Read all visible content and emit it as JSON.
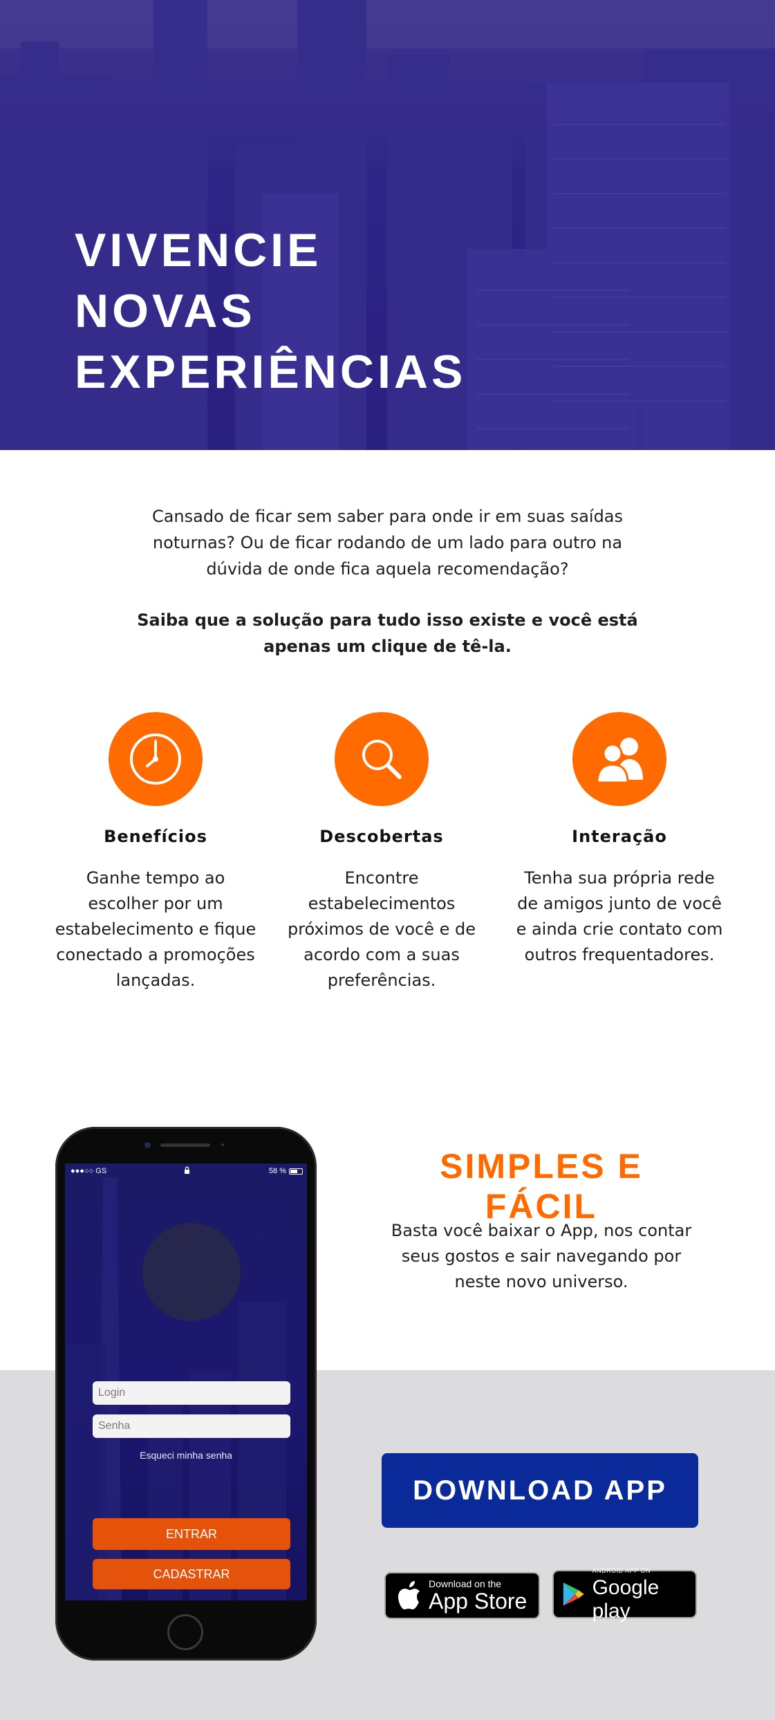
{
  "hero": {
    "title_lines": [
      "VIVENCIE",
      "NOVAS",
      "EXPERIÊNCIAS"
    ]
  },
  "intro": {
    "paragraph": "Cansado de ficar sem saber para onde ir em suas saídas noturnas? Ou de ficar rodando de um lado para outro na dúvida de onde fica aquela recomendação?",
    "highlight": "Saiba que a solução para tudo isso existe e você está apenas um clique de tê-la."
  },
  "features": [
    {
      "icon": "clock-icon",
      "title": "Benefícios",
      "text": "Ganhe tempo ao escolher por um estabelecimento e fique conectado a promoções lançadas."
    },
    {
      "icon": "search-icon",
      "title": "Descobertas",
      "text": "Encontre estabelecimentos próximos de você e de acordo com a suas preferências."
    },
    {
      "icon": "users-icon",
      "title": "Interação",
      "text": "Tenha sua própria rede de amigos junto de você e ainda crie contato com outros frequentadores."
    }
  ],
  "app_section": {
    "title": "SIMPLES E FÁCIL",
    "text": "Basta você baixar o App, nos contar seus gostos e sair navegando por neste novo universo.",
    "download_label": "DOWNLOAD APP",
    "appstore": {
      "small": "Download on the",
      "big": "App Store"
    },
    "googleplay": {
      "small": "ANDROID APP ON",
      "big": "Google play"
    }
  },
  "phone": {
    "status": {
      "carrier": "●●●○○ GS",
      "battery": "58 %"
    },
    "login_placeholder": "Login",
    "password_placeholder": "Senha",
    "forgot": "Esqueci minha senha",
    "enter_label": "ENTRAR",
    "register_label": "CADASTRAR"
  },
  "colors": {
    "accent": "#ff6b00",
    "hero_overlay": "#2f2789",
    "download_button": "#0a2a9a",
    "band": "#dcdbdd"
  }
}
